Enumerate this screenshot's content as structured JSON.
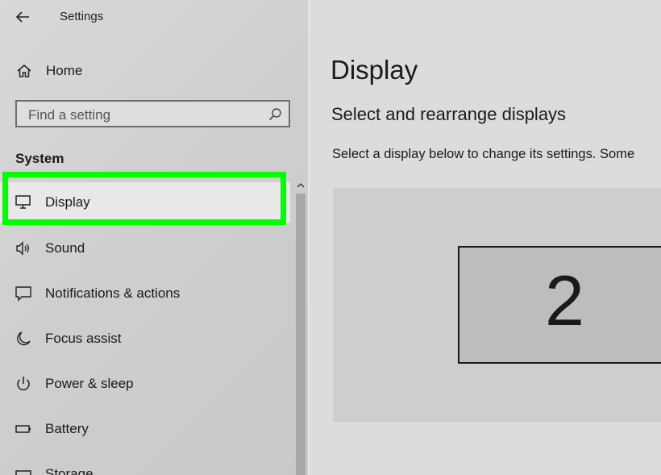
{
  "window": {
    "title": "Settings"
  },
  "sidebar": {
    "home_label": "Home",
    "search": {
      "placeholder": "Find a setting"
    },
    "section_title": "System",
    "items": [
      {
        "label": "Display",
        "icon": "monitor-icon",
        "selected": true
      },
      {
        "label": "Sound",
        "icon": "speaker-icon"
      },
      {
        "label": "Notifications & actions",
        "icon": "notification-icon"
      },
      {
        "label": "Focus assist",
        "icon": "moon-icon"
      },
      {
        "label": "Power & sleep",
        "icon": "power-icon"
      },
      {
        "label": "Battery",
        "icon": "battery-icon"
      },
      {
        "label": "Storage",
        "icon": "storage-icon"
      }
    ]
  },
  "main": {
    "title": "Display",
    "subtitle": "Select and rearrange displays",
    "description": "Select a display below to change its settings. Some",
    "display_number": "2"
  },
  "colors": {
    "highlight": "#00ff00"
  }
}
